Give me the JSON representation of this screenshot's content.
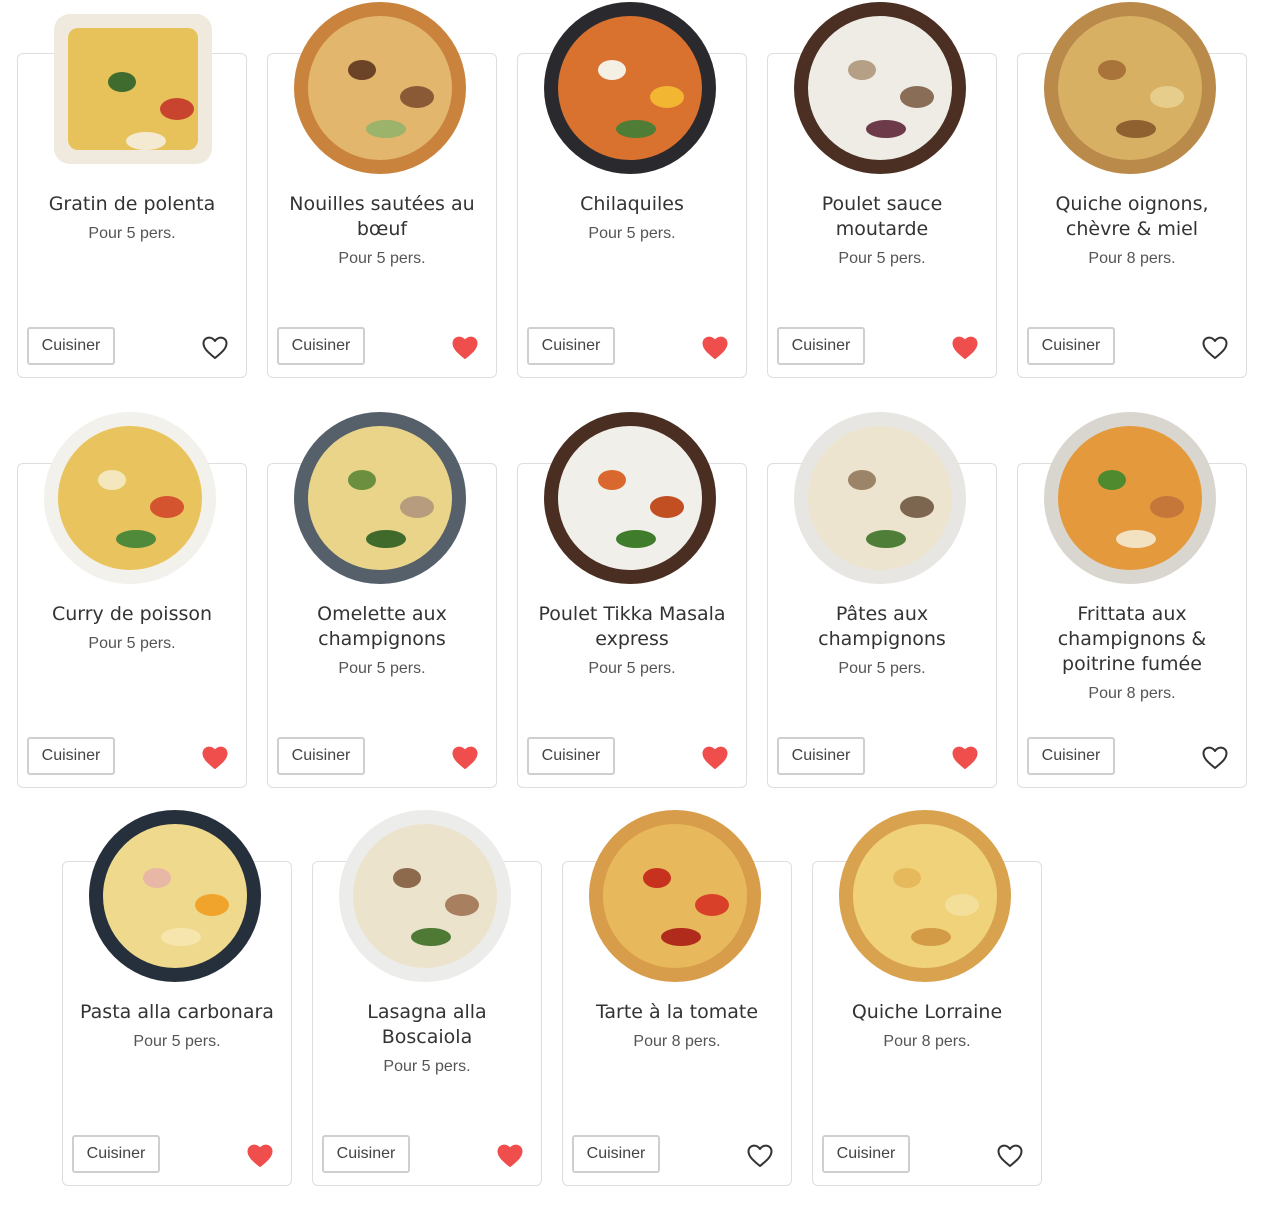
{
  "cards": [
    {
      "title": "Gratin de polenta",
      "servings": "Pour 5 pers.",
      "button": "Cuisiner",
      "favorite": false,
      "plate": "#efe9de",
      "food": "#e7c25a",
      "accent1": "#3f6b2e",
      "accent2": "#c8442f",
      "accent3": "#f4ead2"
    },
    {
      "title": "Nouilles sautées au bœuf",
      "servings": "Pour 5 pers.",
      "button": "Cuisiner",
      "favorite": true,
      "plate": "#c9833d",
      "food": "#e3b66d",
      "accent1": "#6b4326",
      "accent2": "#8a5a36",
      "accent3": "#9bb36a"
    },
    {
      "title": "Chilaquiles",
      "servings": "Pour 5 pers.",
      "button": "Cuisiner",
      "favorite": true,
      "plate": "#2a2a2e",
      "food": "#d9712f",
      "accent1": "#f5f0e4",
      "accent2": "#f2b632",
      "accent3": "#4f7d35"
    },
    {
      "title": "Poulet sauce moutarde",
      "servings": "Pour 5 pers.",
      "button": "Cuisiner",
      "favorite": true,
      "plate": "#4a2f22",
      "food": "#efece6",
      "accent1": "#b5a086",
      "accent2": "#8a6d57",
      "accent3": "#6d3a4a"
    },
    {
      "title": "Quiche oignons, chèvre & miel",
      "servings": "Pour 8 pers.",
      "button": "Cuisiner",
      "favorite": false,
      "plate": "#b98a4a",
      "food": "#d7b064",
      "accent1": "#a8743a",
      "accent2": "#e7cd8b",
      "accent3": "#8f6030"
    },
    {
      "title": "Curry de poisson",
      "servings": "Pour 5 pers.",
      "button": "Cuisiner",
      "favorite": true,
      "plate": "#f3f1ec",
      "food": "#e9c45e",
      "accent1": "#f4e7bd",
      "accent2": "#d3542f",
      "accent3": "#4f8a3a"
    },
    {
      "title": "Omelette aux champignons",
      "servings": "Pour 5 pers.",
      "button": "Cuisiner",
      "favorite": true,
      "plate": "#55606b",
      "food": "#ead48a",
      "accent1": "#6b8f3e",
      "accent2": "#b79d7d",
      "accent3": "#3f6a2b"
    },
    {
      "title": "Poulet Tikka Masala express",
      "servings": "Pour 5 pers.",
      "button": "Cuisiner",
      "favorite": true,
      "plate": "#4a2e22",
      "food": "#f1efea",
      "accent1": "#d9682e",
      "accent2": "#c24f22",
      "accent3": "#3f7d2c"
    },
    {
      "title": "Pâtes aux champignons",
      "servings": "Pour 5 pers.",
      "button": "Cuisiner",
      "favorite": true,
      "plate": "#e7e6e3",
      "food": "#ede4cf",
      "accent1": "#9b8467",
      "accent2": "#7c6650",
      "accent3": "#4f7e38"
    },
    {
      "title": "Frittata aux champignons & poitrine fumée",
      "servings": "Pour 8 pers.",
      "button": "Cuisiner",
      "favorite": false,
      "plate": "#d9d6cf",
      "food": "#e49a3c",
      "accent1": "#4f8a2f",
      "accent2": "#c5773a",
      "accent3": "#f2e2c1"
    },
    {
      "title": "Pasta alla carbonara",
      "servings": "Pour 5 pers.",
      "button": "Cuisiner",
      "favorite": true,
      "plate": "#26303d",
      "food": "#efd98d",
      "accent1": "#e9b7a6",
      "accent2": "#f0a42b",
      "accent3": "#f6e6ad"
    },
    {
      "title": "Lasagna alla Boscaiola",
      "servings": "Pour 5 pers.",
      "button": "Cuisiner",
      "favorite": true,
      "plate": "#ececea",
      "food": "#ece3cd",
      "accent1": "#8c6a4b",
      "accent2": "#a8805f",
      "accent3": "#4f7a36"
    },
    {
      "title": "Tarte à la tomate",
      "servings": "Pour 8 pers.",
      "button": "Cuisiner",
      "favorite": false,
      "plate": "#d89d4a",
      "food": "#e8b85c",
      "accent1": "#c7321f",
      "accent2": "#d8402a",
      "accent3": "#b12b1c"
    },
    {
      "title": "Quiche Lorraine",
      "servings": "Pour 8 pers.",
      "button": "Cuisiner",
      "favorite": false,
      "plate": "#d8a24e",
      "food": "#f0d27b",
      "accent1": "#e7b95d",
      "accent2": "#f3df9a",
      "accent3": "#d39b46"
    }
  ],
  "colors": {
    "favorite_on": "#f04d4d",
    "favorite_off": "#333333"
  },
  "icons": {
    "favorite_on": "heart-filled-icon",
    "favorite_off": "heart-outline-icon"
  }
}
